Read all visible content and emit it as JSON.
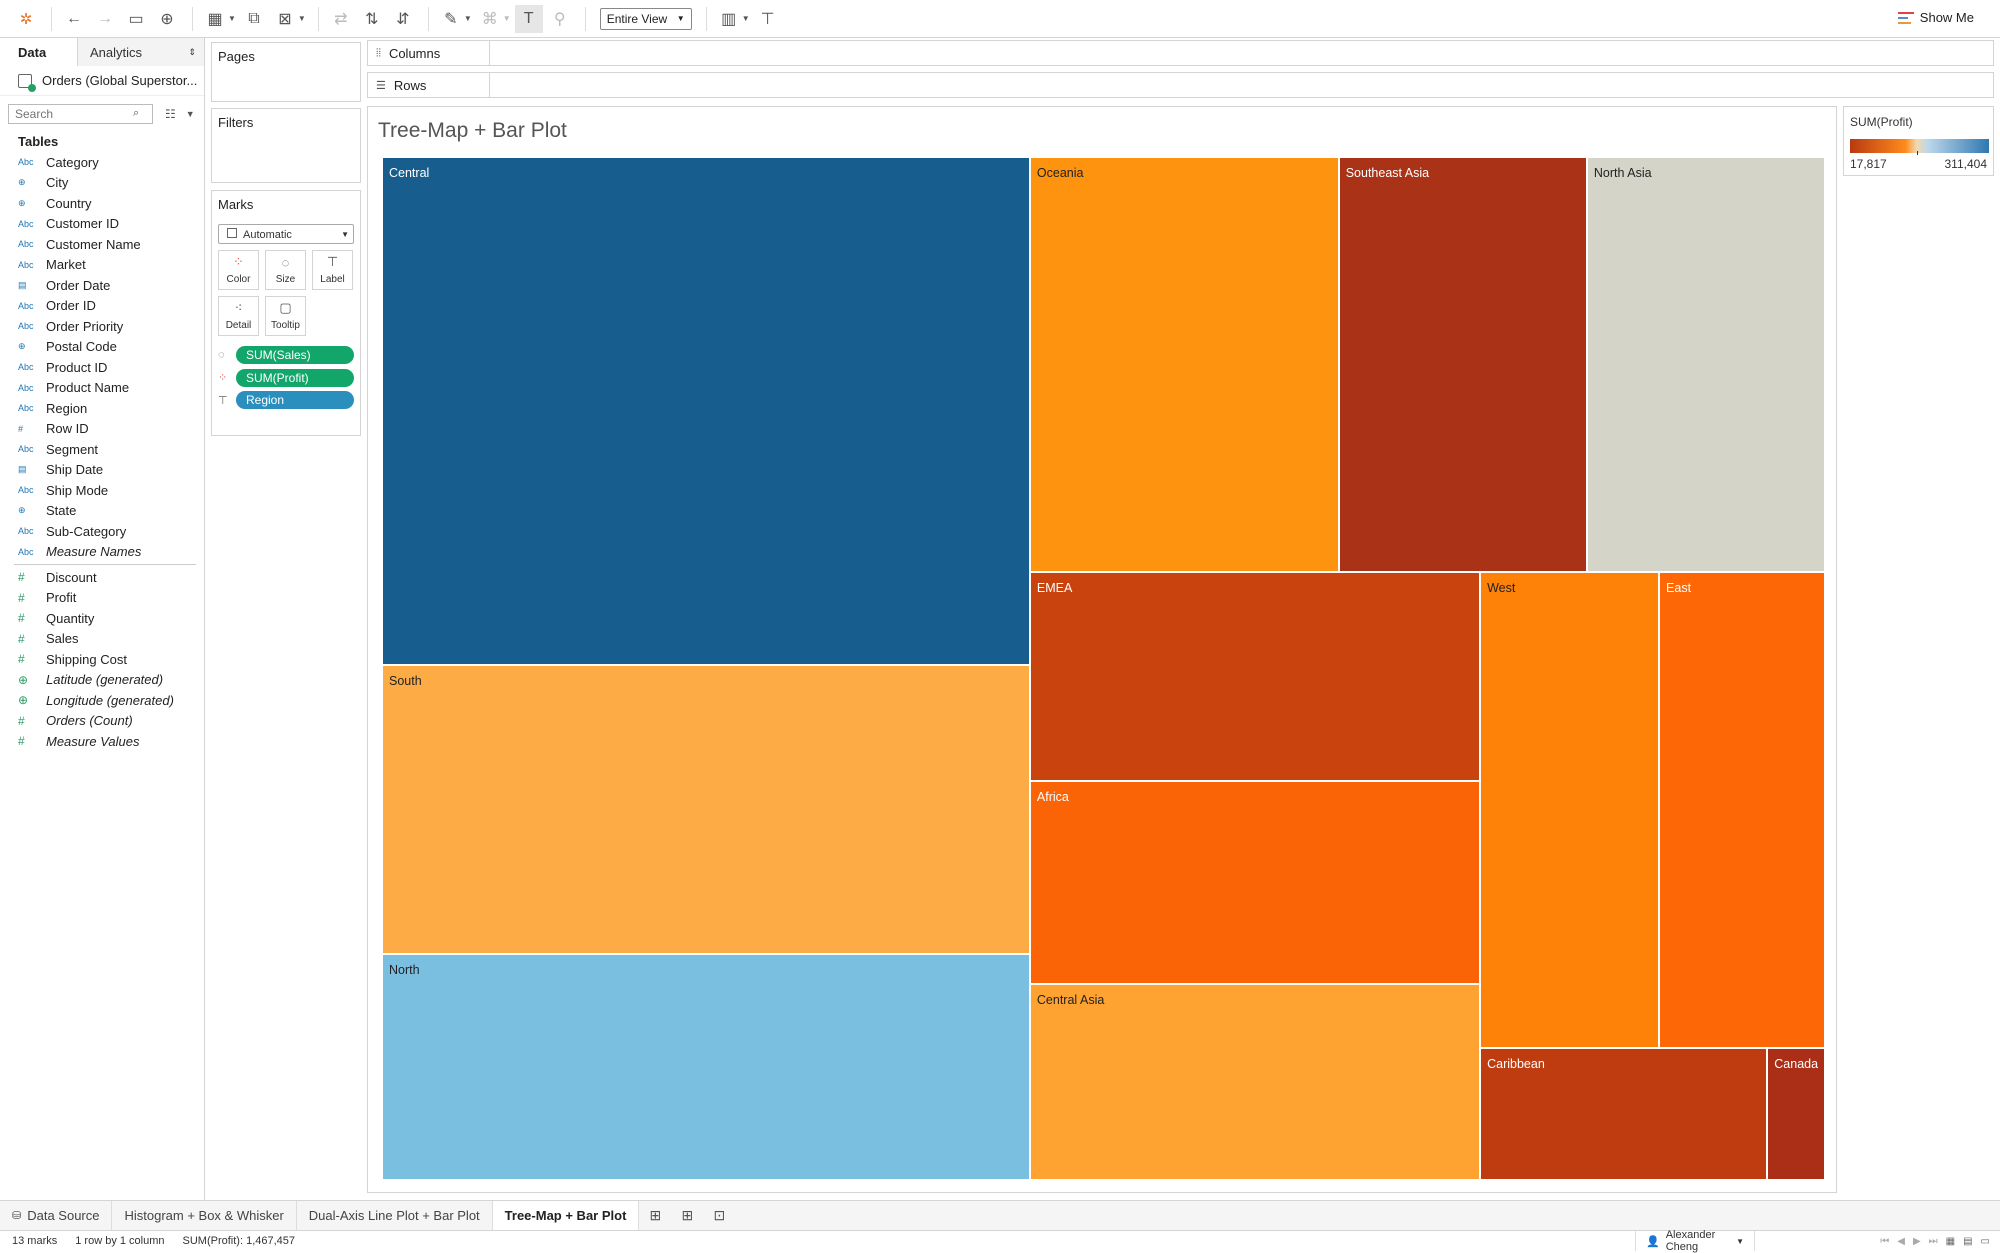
{
  "toolbar": {
    "fit_value": "Entire View",
    "show_me_label": "Show Me"
  },
  "data_pane": {
    "tab_data": "Data",
    "tab_analytics": "Analytics",
    "datasource": "Orders (Global Superstor...",
    "search_placeholder": "Search",
    "tables_label": "Tables",
    "fields": [
      {
        "type": "Abc",
        "kind": "dim",
        "name": "Category"
      },
      {
        "type": "globe",
        "kind": "dim",
        "name": "City"
      },
      {
        "type": "globe",
        "kind": "dim",
        "name": "Country"
      },
      {
        "type": "Abc",
        "kind": "dim",
        "name": "Customer ID"
      },
      {
        "type": "Abc",
        "kind": "dim",
        "name": "Customer Name"
      },
      {
        "type": "Abc",
        "kind": "dim",
        "name": "Market"
      },
      {
        "type": "date",
        "kind": "dim",
        "name": "Order Date"
      },
      {
        "type": "Abc",
        "kind": "dim",
        "name": "Order ID"
      },
      {
        "type": "Abc",
        "kind": "dim",
        "name": "Order Priority"
      },
      {
        "type": "globe",
        "kind": "dim",
        "name": "Postal Code"
      },
      {
        "type": "Abc",
        "kind": "dim",
        "name": "Product ID"
      },
      {
        "type": "Abc",
        "kind": "dim",
        "name": "Product Name"
      },
      {
        "type": "Abc",
        "kind": "dim",
        "name": "Region"
      },
      {
        "type": "#",
        "kind": "dim",
        "name": "Row ID"
      },
      {
        "type": "Abc",
        "kind": "dim",
        "name": "Segment"
      },
      {
        "type": "date",
        "kind": "dim",
        "name": "Ship Date"
      },
      {
        "type": "Abc",
        "kind": "dim",
        "name": "Ship Mode"
      },
      {
        "type": "globe",
        "kind": "dim",
        "name": "State"
      },
      {
        "type": "Abc",
        "kind": "dim",
        "name": "Sub-Category"
      },
      {
        "type": "Abc",
        "kind": "dim",
        "name": "Measure Names",
        "italic": true
      }
    ],
    "measures": [
      {
        "type": "#",
        "kind": "mea",
        "name": "Discount"
      },
      {
        "type": "#",
        "kind": "mea",
        "name": "Profit"
      },
      {
        "type": "#",
        "kind": "mea",
        "name": "Quantity"
      },
      {
        "type": "#",
        "kind": "mea",
        "name": "Sales"
      },
      {
        "type": "#",
        "kind": "mea",
        "name": "Shipping Cost"
      },
      {
        "type": "globe",
        "kind": "mea",
        "name": "Latitude (generated)",
        "italic": true
      },
      {
        "type": "globe",
        "kind": "mea",
        "name": "Longitude (generated)",
        "italic": true
      },
      {
        "type": "#",
        "kind": "mea",
        "name": "Orders (Count)",
        "italic": true
      },
      {
        "type": "#",
        "kind": "mea",
        "name": "Measure Values",
        "italic": true
      }
    ]
  },
  "cards": {
    "pages": "Pages",
    "filters": "Filters",
    "marks": "Marks",
    "mark_type": "Automatic",
    "mark_buttons": [
      "Color",
      "Size",
      "Label",
      "Detail",
      "Tooltip"
    ],
    "pills": [
      {
        "label": "SUM(Sales)",
        "color": "green"
      },
      {
        "label": "SUM(Profit)",
        "color": "green"
      },
      {
        "label": "Region",
        "color": "blue"
      }
    ]
  },
  "shelves": {
    "columns": "Columns",
    "rows": "Rows"
  },
  "viz": {
    "title": "Tree-Map + Bar Plot"
  },
  "chart_data": {
    "type": "treemap",
    "title": "Tree-Map + Bar Plot",
    "size_measure": "SUM(Sales)",
    "color_measure": "SUM(Profit)",
    "label_field": "Region",
    "tiles": [
      {
        "label": "Central",
        "color": "#175e8f",
        "text_color": "#ffffff"
      },
      {
        "label": "South",
        "color": "#fdab45",
        "text_color": "#222222"
      },
      {
        "label": "North",
        "color": "#7bbfe0",
        "text_color": "#222222"
      },
      {
        "label": "Oceania",
        "color": "#fd930e",
        "text_color": "#222222"
      },
      {
        "label": "Southeast Asia",
        "color": "#aa3216",
        "text_color": "#ffffff"
      },
      {
        "label": "North Asia",
        "color": "#d5d4c8",
        "text_color": "#222222"
      },
      {
        "label": "EMEA",
        "color": "#c9430f",
        "text_color": "#ffffff"
      },
      {
        "label": "Africa",
        "color": "#fa6306",
        "text_color": "#ffffff"
      },
      {
        "label": "Central Asia",
        "color": "#fea231",
        "text_color": "#222222"
      },
      {
        "label": "West",
        "color": "#fe8208",
        "text_color": "#222222"
      },
      {
        "label": "East",
        "color": "#fd6706",
        "text_color": "#ffffff"
      },
      {
        "label": "Caribbean",
        "color": "#be3c10",
        "text_color": "#ffffff"
      },
      {
        "label": "Canada",
        "color": "#aa2f16",
        "text_color": "#ffffff"
      }
    ],
    "legend": {
      "title": "SUM(Profit)",
      "min": "17,817",
      "max": "311,404"
    }
  },
  "sheets": {
    "data_source": "Data Source",
    "tabs": [
      "Histogram + Box & Whisker",
      "Dual-Axis Line Plot + Bar Plot",
      "Tree-Map + Bar Plot"
    ],
    "active": 2
  },
  "status": {
    "marks": "13 marks",
    "dims": "1 row by 1 column",
    "sum": "SUM(Profit): 1,467,457",
    "user": "Alexander Cheng"
  }
}
